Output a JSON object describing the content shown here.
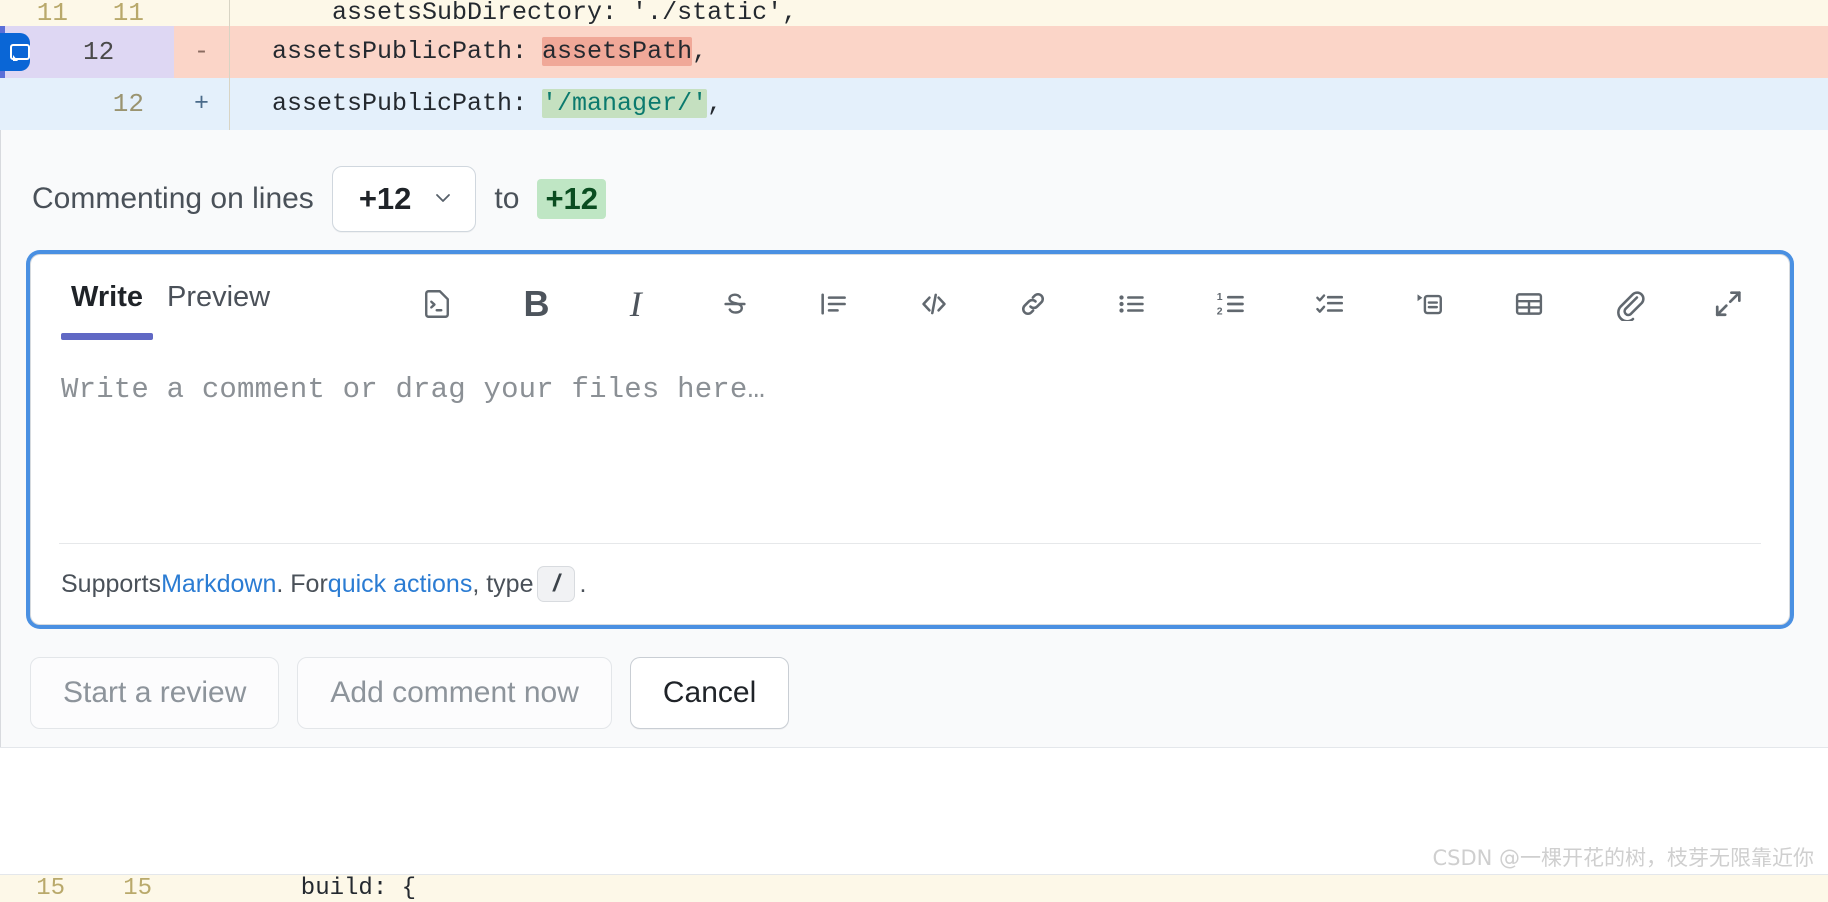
{
  "diff": {
    "context_row": {
      "line_old": "11",
      "line_new": "11",
      "marker": "",
      "code": "    assetsSubDirectory: './static',"
    },
    "deleted_row": {
      "line_old": "12",
      "marker": "-",
      "code_prefix": "assetsPublicPath: ",
      "code_highlight": "assetsPath",
      "code_suffix": ","
    },
    "added_row": {
      "line_new": "12",
      "marker": "+",
      "code_prefix": "assetsPublicPath: ",
      "code_highlight": "'/manager/'",
      "code_suffix": ","
    },
    "bottom_row": {
      "line_old": "15",
      "line_new": "15",
      "code": "  build: {"
    }
  },
  "commenting": {
    "label": "Commenting on lines",
    "start_line": "+12",
    "chevron": "chevron-down-icon",
    "to": "to",
    "end_line": "+12"
  },
  "editor": {
    "tabs": [
      {
        "label": "Write",
        "active": true
      },
      {
        "label": "Preview",
        "active": false
      }
    ],
    "toolbar": [
      {
        "name": "copilot-suggest-icon",
        "title": "Suggest with Copilot"
      },
      {
        "name": "bold-icon",
        "title": "Bold",
        "glyph": "B"
      },
      {
        "name": "italic-icon",
        "title": "Italic",
        "glyph": "I"
      },
      {
        "name": "strikethrough-icon",
        "title": "Strikethrough"
      },
      {
        "name": "blockquote-icon",
        "title": "Quote"
      },
      {
        "name": "code-icon",
        "title": "Code"
      },
      {
        "name": "link-icon",
        "title": "Link"
      },
      {
        "name": "unordered-list-icon",
        "title": "Unordered list"
      },
      {
        "name": "ordered-list-icon",
        "title": "Numbered list"
      },
      {
        "name": "task-list-icon",
        "title": "Task list"
      },
      {
        "name": "saved-reply-icon",
        "title": "Saved replies"
      },
      {
        "name": "table-icon",
        "title": "Add a table"
      },
      {
        "name": "attach-files-icon",
        "title": "Attach files"
      },
      {
        "name": "fullscreen-icon",
        "title": "Fullscreen"
      }
    ],
    "placeholder": "Write a comment or drag your files here…",
    "value": "",
    "footer": {
      "supports": "Supports ",
      "markdown_link": "Markdown",
      "mid": ". For ",
      "quick_actions_link": "quick actions",
      "type": ", type ",
      "kbd": "/",
      "period": "."
    }
  },
  "actions": [
    {
      "label": "Start a review",
      "state": "disabled",
      "name": "start-a-review-button"
    },
    {
      "label": "Add comment now",
      "state": "disabled",
      "name": "add-comment-now-button"
    },
    {
      "label": "Cancel",
      "state": "enabled",
      "name": "cancel-button"
    }
  ],
  "watermark": "CSDN @一棵开花的树，枝芽无限靠近你",
  "colors": {
    "focus_ring": "#4a90e2",
    "link": "#2b7cd3",
    "tab_underline": "#6068c4",
    "deleted_bg": "#fbd5c8",
    "deleted_highlight": "#f0a898",
    "added_bg": "#e4f0fb",
    "added_highlight": "#c5e0c0",
    "context_bg": "#fdf8e8",
    "comment_marker": "#0a66d6"
  }
}
